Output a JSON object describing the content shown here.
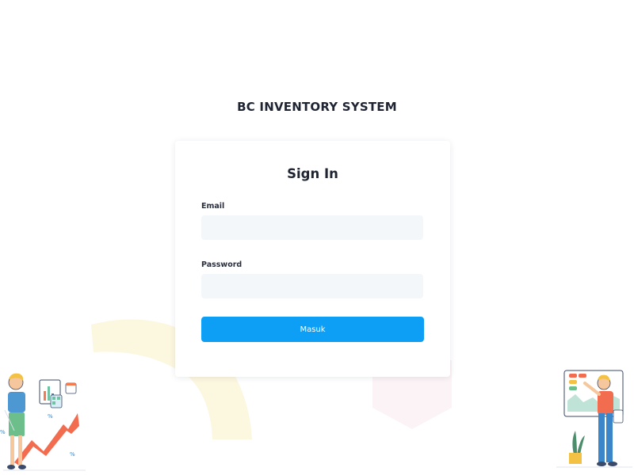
{
  "app": {
    "title": "BC INVENTORY SYSTEM"
  },
  "signin": {
    "heading": "Sign In",
    "email_label": "Email",
    "email_value": "",
    "password_label": "Password",
    "password_value": "",
    "submit_label": "Masuk"
  },
  "illustrations": {
    "left": "person-with-growth-chart-illustration",
    "right": "person-at-dashboard-board-illustration"
  },
  "colors": {
    "accent": "#0d9ff5",
    "input_bg": "#f4f7fa",
    "title_text": "#1f2433"
  }
}
